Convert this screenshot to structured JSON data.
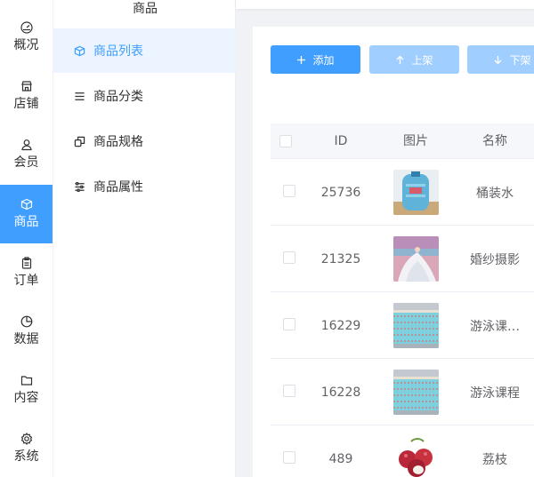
{
  "nav": {
    "items": [
      {
        "label": "概况",
        "icon": "dashboard-icon",
        "active": false
      },
      {
        "label": "店铺",
        "icon": "shop-icon",
        "active": false
      },
      {
        "label": "会员",
        "icon": "user-icon",
        "active": false
      },
      {
        "label": "商品",
        "icon": "goods-box-icon",
        "active": true
      },
      {
        "label": "订单",
        "icon": "clipboard-icon",
        "active": false
      },
      {
        "label": "数据",
        "icon": "pie-chart-icon",
        "active": false
      },
      {
        "label": "内容",
        "icon": "folder-icon",
        "active": false
      },
      {
        "label": "系统",
        "icon": "gear-icon",
        "active": false
      }
    ]
  },
  "submenu": {
    "title": "商品",
    "items": [
      {
        "label": "商品列表",
        "icon": "box-icon",
        "active": true
      },
      {
        "label": "商品分类",
        "icon": "list-icon",
        "active": false
      },
      {
        "label": "商品规格",
        "icon": "copy-icon",
        "active": false
      },
      {
        "label": "商品属性",
        "icon": "sliders-icon",
        "active": false
      }
    ]
  },
  "toolbar": {
    "add_label": "添加",
    "up_label": "上架",
    "down_label": "下架"
  },
  "table": {
    "columns": [
      "ID",
      "图片",
      "名称"
    ],
    "rows": [
      {
        "id": "25736",
        "name": "桶装水",
        "thumb": "water-bottle-image"
      },
      {
        "id": "21325",
        "name": "婚纱摄影",
        "thumb": "wedding-photo-image"
      },
      {
        "id": "16229",
        "name": "游泳课…",
        "thumb": "swimming-pool-image"
      },
      {
        "id": "16228",
        "name": "游泳课程",
        "thumb": "swimming-pool-image"
      },
      {
        "id": "489",
        "name": "荔枝",
        "thumb": "lychee-image"
      }
    ]
  },
  "colors": {
    "primary": "#409eff",
    "primary_light": "#a0cfff",
    "active_bg": "#ecf5ff"
  }
}
